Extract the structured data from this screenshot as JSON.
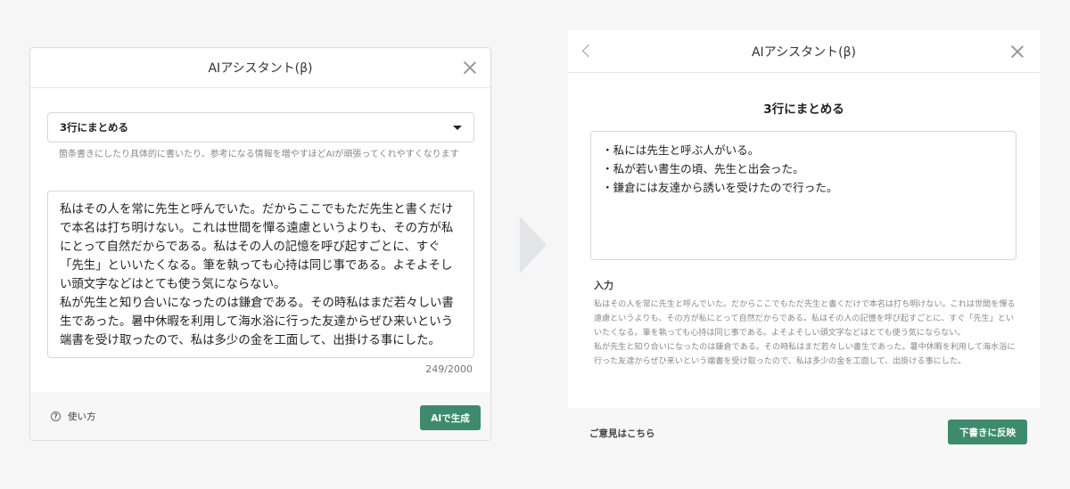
{
  "left_dialog": {
    "title": "AIアシスタント(β)",
    "mode_select": {
      "value": "3行にまとめる"
    },
    "hint": "箇条書きにしたり具体的に書いたり、参考になる情報を増やすほどAIが頑張ってくれやすくなります",
    "input_text": "私はその人を常に先生と呼んでいた。だからここでもただ先生と書くだけで本名は打ち明けない。これは世間を憚る遠慮というよりも、その方が私にとって自然だからである。私はその人の記憶を呼び起すごとに、すぐ「先生」といいたくなる。筆を執っても心持は同じ事である。よそよそしい頭文字などはとても使う気にならない。\n私が先生と知り合いになったのは鎌倉である。その時私はまだ若々しい書生であった。暑中休暇を利用して海水浴に行った友達からぜひ来いという端書を受け取ったので、私は多少の金を工面して、出掛ける事にした。",
    "char_count": "249/2000",
    "help_label": "使い方",
    "help_icon": "question-circle-icon",
    "generate_button": "AIで生成"
  },
  "right_dialog": {
    "title": "AIアシスタント(β)",
    "mode_title": "3行にまとめる",
    "result_lines": [
      "・私には先生と呼ぶ人がいる。",
      "・私が若い書生の頃、先生と出会った。",
      "・鎌倉には友達から誘いを受けたので行った。"
    ],
    "input_label": "入力",
    "input_text": "私はその人を常に先生と呼んでいた。だからここでもただ先生と書くだけで本名は打ち明けない。これは世間を憚る遠慮というよりも、その方が私にとって自然だからである。私はその人の記憶を呼び起すごとに、すぐ「先生」といいたくなる。筆を執っても心持は同じ事である。よそよそしい頭文字などはとても使う気にならない。\n私が先生と知り合いになったのは鎌倉である。その時私はまだ若々しい書生であった。暑中休暇を利用して海水浴に行った友達からぜひ来いという端書を受け取ったので、私は多少の金を工面して、出掛ける事にした。",
    "feedback_link": "ご意見はこちら",
    "apply_button": "下書きに反映"
  },
  "colors": {
    "accent_green": "#3d8a6f",
    "arrow": "#e2e5e8"
  }
}
